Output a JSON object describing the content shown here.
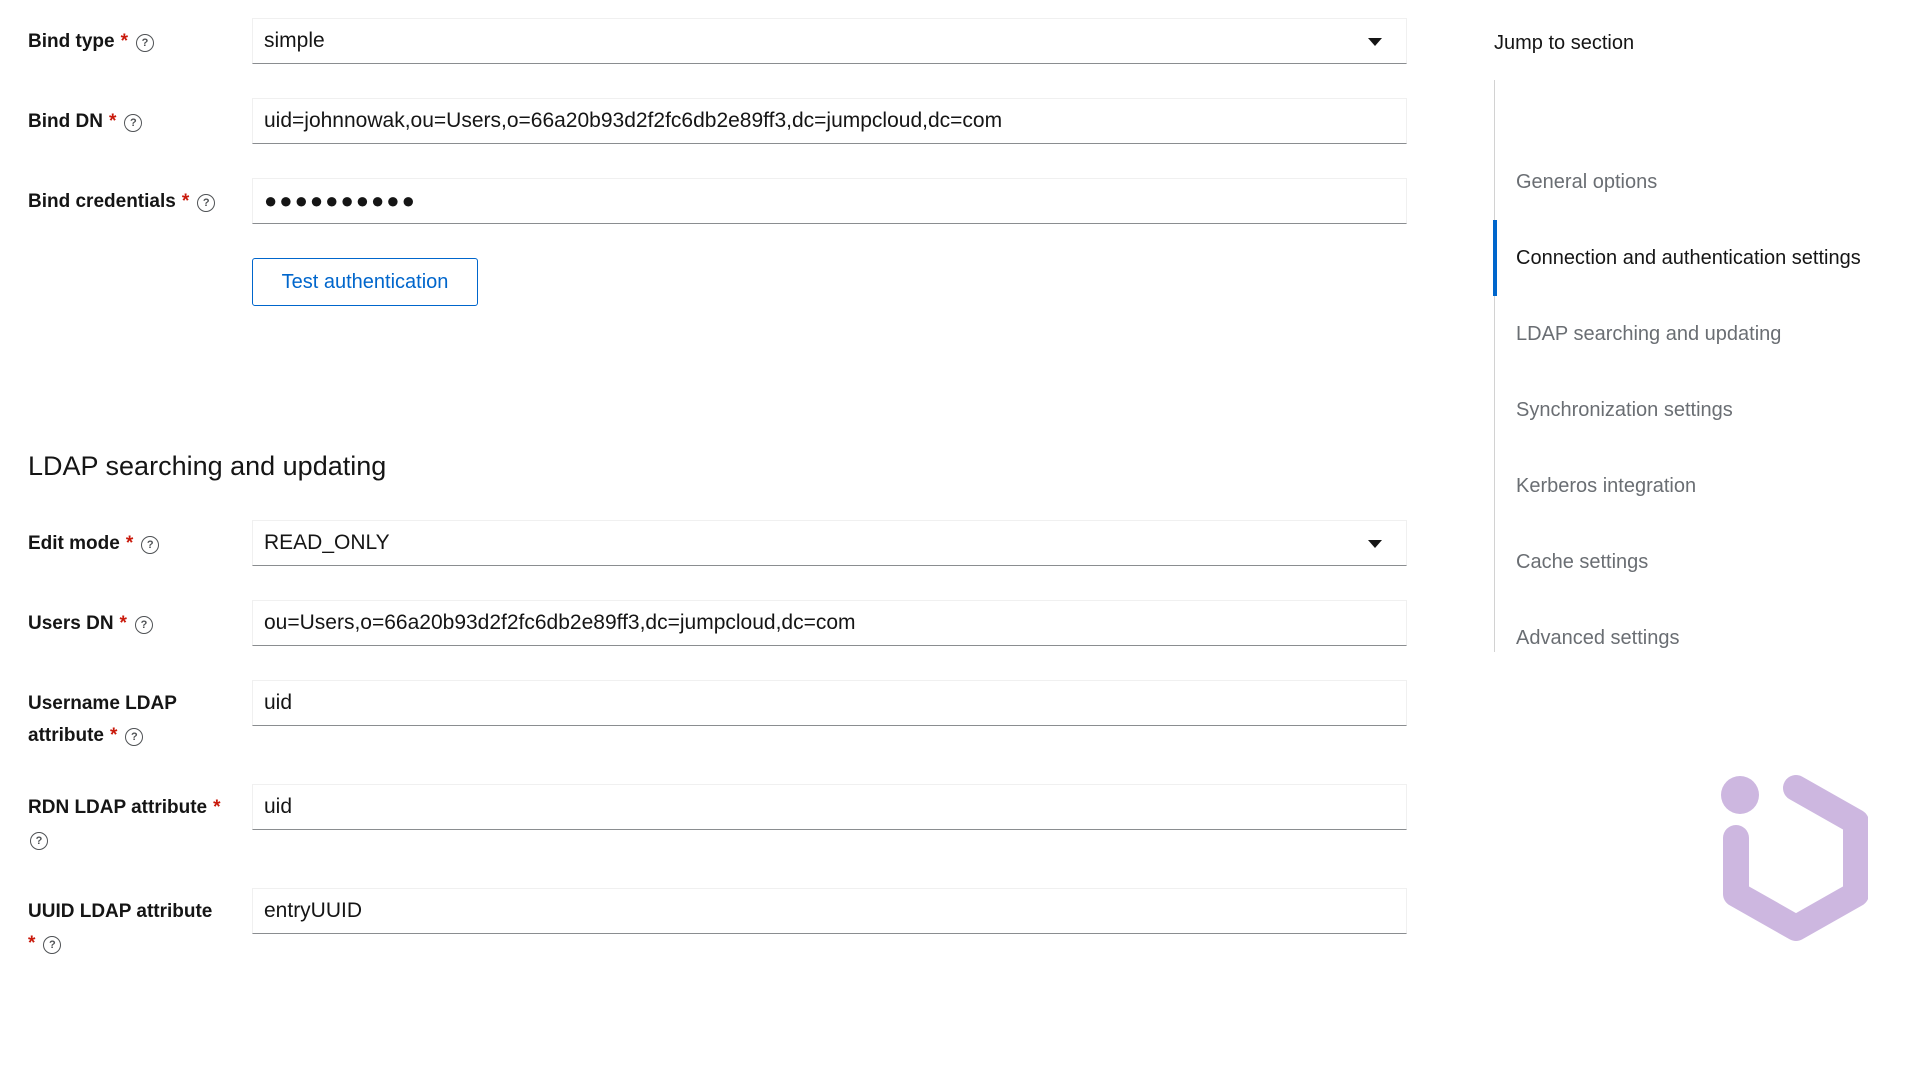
{
  "form": {
    "bind_type": {
      "label": "Bind type",
      "value": "simple"
    },
    "bind_dn": {
      "label": "Bind DN",
      "value": "uid=johnnowak,ou=Users,o=66a20b93d2f2fc6db2e89ff3,dc=jumpcloud,dc=com"
    },
    "bind_credentials": {
      "label": "Bind credentials",
      "value": "●●●●●●●●●●"
    },
    "test_auth_label": "Test authentication",
    "section_title": "LDAP searching and updating",
    "edit_mode": {
      "label": "Edit mode",
      "value": "READ_ONLY"
    },
    "users_dn": {
      "label": "Users DN",
      "value": "ou=Users,o=66a20b93d2f2fc6db2e89ff3,dc=jumpcloud,dc=com"
    },
    "username_ldap_attribute": {
      "label_line1": "Username LDAP",
      "label_line2": "attribute",
      "value": "uid"
    },
    "rdn_ldap_attribute": {
      "label": "RDN LDAP attribute",
      "value": "uid"
    },
    "uuid_ldap_attribute": {
      "label": "UUID LDAP attribute",
      "value": "entryUUID"
    },
    "required_marker": "*",
    "help_glyph": "?"
  },
  "jump": {
    "title": "Jump to section",
    "items": [
      {
        "label": "General options",
        "active": false
      },
      {
        "label": "Connection and authentication settings",
        "active": true
      },
      {
        "label": "LDAP searching and updating",
        "active": false
      },
      {
        "label": "Synchronization settings",
        "active": false
      },
      {
        "label": "Kerberos integration",
        "active": false
      },
      {
        "label": "Cache settings",
        "active": false
      },
      {
        "label": "Advanced settings",
        "active": false
      }
    ]
  },
  "icons": {
    "help": "question-circle-icon",
    "caret": "caret-down-icon",
    "logo": "hexagon-logo-icon"
  },
  "colors": {
    "accent": "#0066cc",
    "required": "#c9190b",
    "muted_text": "#6a6e73",
    "logo": "#cdb7e0"
  }
}
